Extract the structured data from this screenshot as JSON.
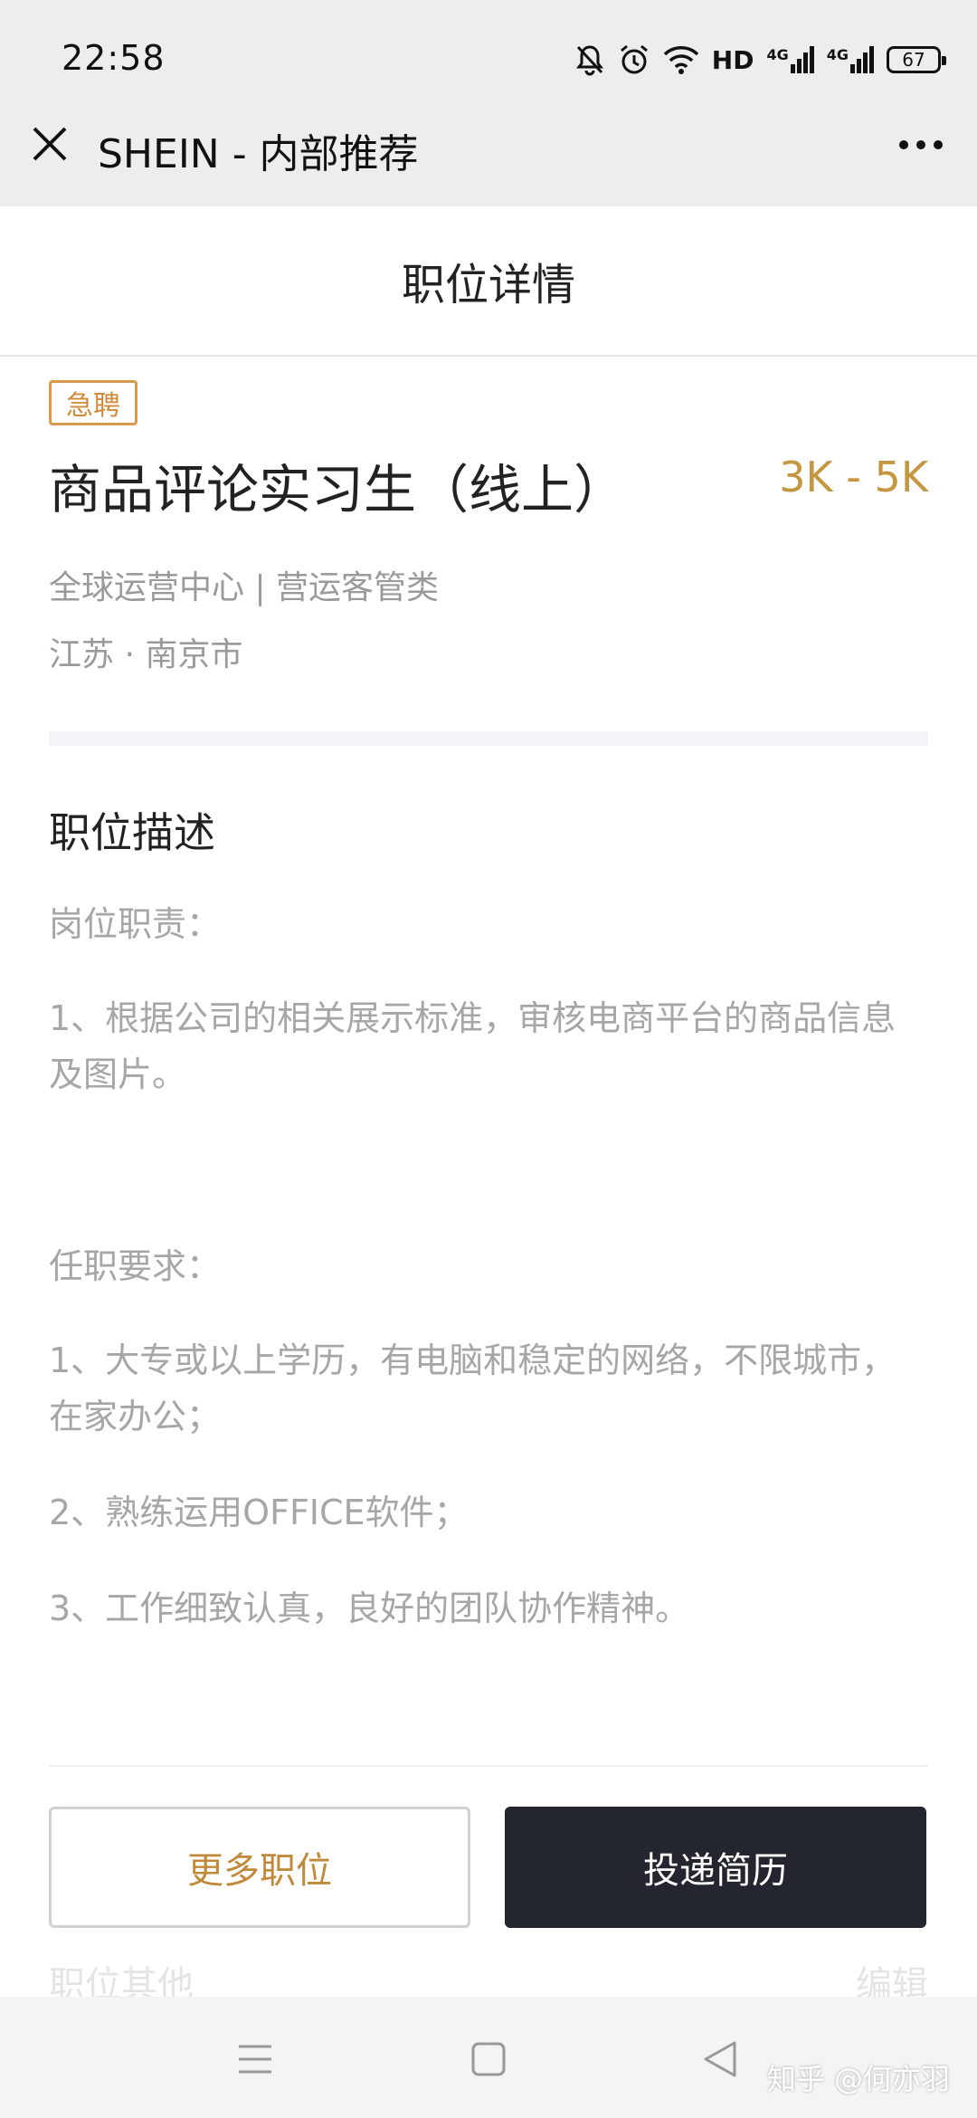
{
  "status_bar": {
    "time": "22:58",
    "network_label": "HD",
    "signal_1": "4G",
    "signal_2": "4G",
    "battery": "67"
  },
  "webview": {
    "title": "SHEIN - 内部推荐"
  },
  "page": {
    "title": "职位详情"
  },
  "job": {
    "badge": "急聘",
    "title": "商品评论实习生（线上）",
    "salary": "3K - 5K",
    "department": "全球运营中心 | 营运客管类",
    "location": "江苏 · 南京市"
  },
  "description": {
    "section_title": "职位描述",
    "duties_heading": "岗位职责：",
    "duty_1": "1、根据公司的相关展示标准，审核电商平台的商品信息及图片。",
    "requirements_heading": "任职要求：",
    "req_1": "1、大专或以上学历，有电脑和稳定的网络，不限城市，在家办公；",
    "req_2": "2、熟练运用OFFICE软件；",
    "req_3": "3、工作细致认真，良好的团队协作精神。"
  },
  "behind": {
    "left": "职位其他",
    "right": "编辑"
  },
  "actions": {
    "more_jobs": "更多职位",
    "apply": "投递简历"
  },
  "watermark": "知乎 @何亦羽",
  "colors": {
    "accent_gold": "#c4963f",
    "badge_orange": "#d99a4e",
    "dark_button": "#23262e"
  }
}
